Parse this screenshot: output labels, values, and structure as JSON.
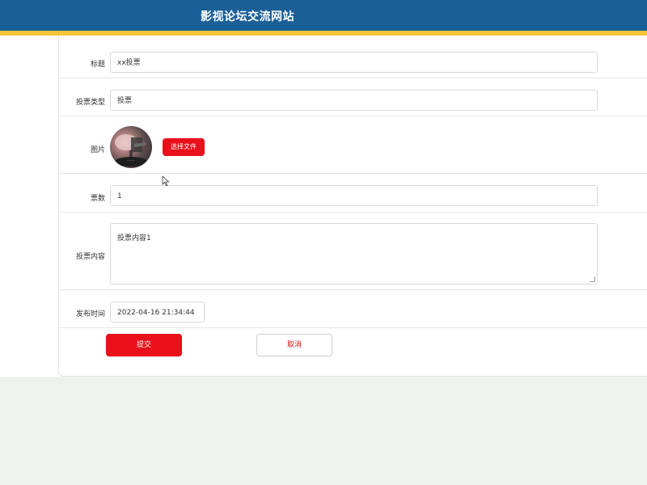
{
  "header": {
    "title": "影视论坛交流网站"
  },
  "form": {
    "title_label": "标题",
    "title_value": "xx投票",
    "type_label": "投票类型",
    "type_value": "投票",
    "image_label": "图片",
    "choose_file_label": "选择文件",
    "count_label": "票数",
    "count_value": "1",
    "content_label": "投票内容",
    "content_value": "投票内容1",
    "time_label": "发布时间",
    "time_value": "2022-04-16 21:34:44"
  },
  "actions": {
    "submit_label": "提交",
    "cancel_label": "取消"
  },
  "colors": {
    "header": "#1a5f97",
    "stripe": "#f5c53a",
    "accent": "#e8101a",
    "page_bg": "#eef2ee"
  }
}
